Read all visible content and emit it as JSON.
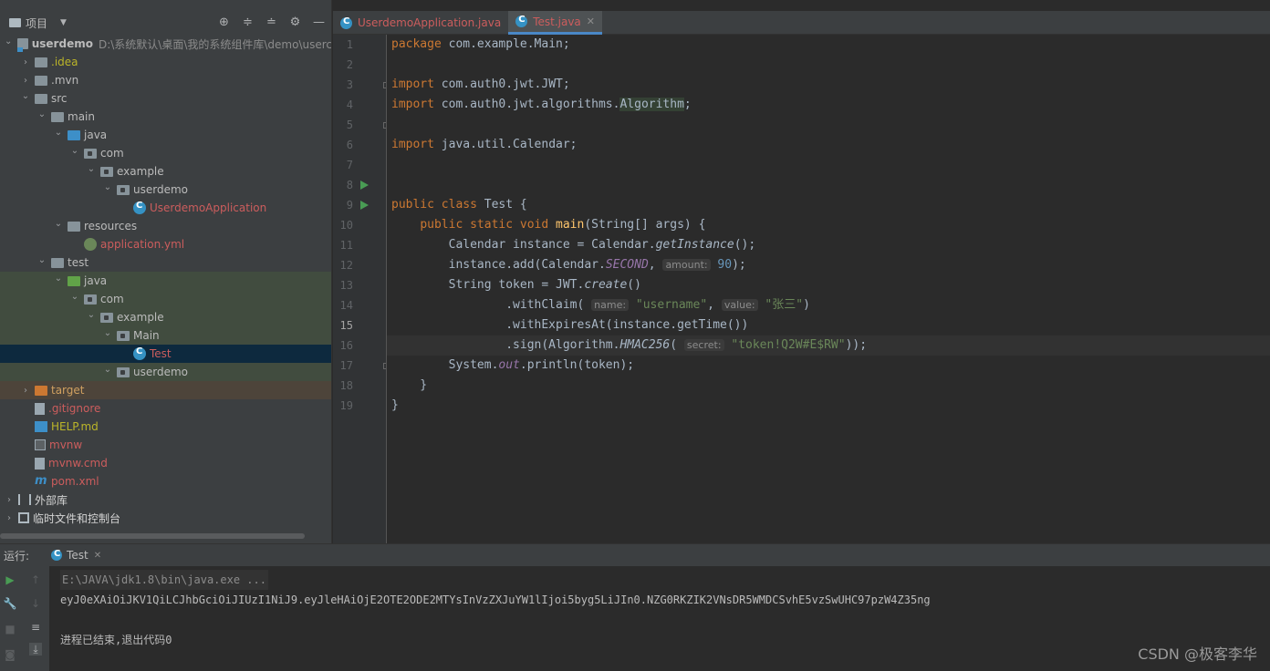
{
  "project_panel": {
    "title": "项目",
    "tree": [
      {
        "label": "userdemo",
        "path": "D:\\系统默认\\桌面\\我的系统组件库\\demo\\userc",
        "icon": "module-icon",
        "arrow": "down",
        "depth": 0,
        "style": "bold"
      },
      {
        "label": ".idea",
        "icon": "folder-icon",
        "arrow": "right",
        "depth": 1,
        "style": "yellow"
      },
      {
        "label": ".mvn",
        "icon": "folder-icon",
        "arrow": "right",
        "depth": 1,
        "style": "normal"
      },
      {
        "label": "src",
        "icon": "folder-icon",
        "arrow": "down",
        "depth": 1,
        "style": "normal"
      },
      {
        "label": "main",
        "icon": "folder-icon",
        "arrow": "down",
        "depth": 2,
        "style": "normal"
      },
      {
        "label": "java",
        "icon": "source-folder-icon",
        "arrow": "down",
        "depth": 3,
        "style": "normal"
      },
      {
        "label": "com",
        "icon": "package-icon",
        "arrow": "down",
        "depth": 4,
        "style": "normal"
      },
      {
        "label": "example",
        "icon": "package-icon",
        "arrow": "down",
        "depth": 5,
        "style": "normal"
      },
      {
        "label": "userdemo",
        "icon": "package-icon",
        "arrow": "down",
        "depth": 6,
        "style": "normal"
      },
      {
        "label": "UserdemoApplication",
        "icon": "spring-class-icon",
        "arrow": "none",
        "depth": 7,
        "style": "red"
      },
      {
        "label": "resources",
        "icon": "resources-folder-icon",
        "arrow": "down",
        "depth": 3,
        "style": "normal"
      },
      {
        "label": "application.yml",
        "icon": "yml-file-icon",
        "arrow": "none",
        "depth": 4,
        "style": "red"
      },
      {
        "label": "test",
        "icon": "folder-icon",
        "arrow": "down",
        "depth": 2,
        "style": "normal"
      },
      {
        "label": "java",
        "icon": "test-folder-icon",
        "arrow": "down",
        "depth": 3,
        "style": "normal",
        "highlight": "green"
      },
      {
        "label": "com",
        "icon": "package-icon",
        "arrow": "down",
        "depth": 4,
        "style": "normal",
        "highlight": "green"
      },
      {
        "label": "example",
        "icon": "package-icon",
        "arrow": "down",
        "depth": 5,
        "style": "normal",
        "highlight": "green"
      },
      {
        "label": "Main",
        "icon": "package-icon",
        "arrow": "down",
        "depth": 6,
        "style": "normal",
        "highlight": "green"
      },
      {
        "label": "Test",
        "icon": "class-icon",
        "arrow": "none",
        "depth": 7,
        "style": "red",
        "highlight": "selected"
      },
      {
        "label": "userdemo",
        "icon": "package-icon",
        "arrow": "down",
        "depth": 6,
        "style": "normal",
        "highlight": "green"
      },
      {
        "label": "target",
        "icon": "excluded-folder-icon",
        "arrow": "right",
        "depth": 1,
        "style": "orange",
        "highlight": "brown"
      },
      {
        "label": ".gitignore",
        "icon": "gitignore-file-icon",
        "arrow": "none",
        "depth": 1,
        "style": "red"
      },
      {
        "label": "HELP.md",
        "icon": "markdown-file-icon",
        "arrow": "none",
        "depth": 1,
        "style": "yellow"
      },
      {
        "label": "mvnw",
        "icon": "shell-file-icon",
        "arrow": "none",
        "depth": 1,
        "style": "red"
      },
      {
        "label": "mvnw.cmd",
        "icon": "text-file-icon",
        "arrow": "none",
        "depth": 1,
        "style": "red"
      },
      {
        "label": "pom.xml",
        "icon": "maven-file-icon",
        "arrow": "none",
        "depth": 1,
        "style": "red"
      },
      {
        "label": "外部库",
        "icon": "library-icon",
        "arrow": "right",
        "depth": 0,
        "style": "white"
      },
      {
        "label": "临时文件和控制台",
        "icon": "scratch-icon",
        "arrow": "right",
        "depth": 0,
        "style": "white"
      }
    ]
  },
  "editor": {
    "tabs": [
      {
        "label": "UserdemoApplication.java",
        "active": false
      },
      {
        "label": "Test.java",
        "active": true
      }
    ],
    "current_line": 15,
    "line_numbers": [
      "1",
      "2",
      "3",
      "4",
      "5",
      "6",
      "7",
      "8",
      "9",
      "10",
      "11",
      "12",
      "13",
      "14",
      "15",
      "16",
      "17",
      "18",
      "19"
    ]
  },
  "run_panel": {
    "label": "运行:",
    "tab": "Test",
    "console": [
      "E:\\JAVA\\jdk1.8\\bin\\java.exe ...",
      "eyJ0eXAiOiJKV1QiLCJhbGciOiJIUzI1NiJ9.eyJleHAiOjE2OTE2ODE2MTYsInVzZXJuYW1lIjoi5byg5LiJIn0.NZG0RKZIK2VNsDR5WMDCSvhE5vzSwUHC97pzW4Z35ng",
      "",
      "进程已结束,退出代码0"
    ]
  },
  "watermark": "CSDN @极客李华"
}
